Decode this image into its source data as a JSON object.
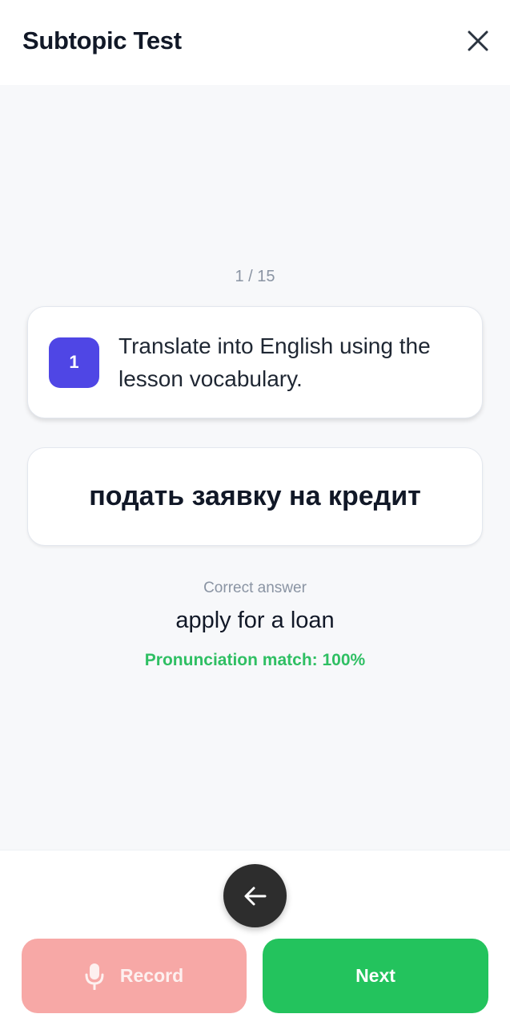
{
  "header": {
    "title": "Subtopic Test",
    "close_icon": "close-icon"
  },
  "progress": {
    "counter": "1 / 15"
  },
  "question": {
    "number": "1",
    "prompt": "Translate into English using the lesson vocabulary.",
    "accent_color": "#4f46e5"
  },
  "phrase": {
    "text": "подать заявку на кредит"
  },
  "answer": {
    "label": "Correct answer",
    "text": "apply for a loan",
    "pronunciation": "Pronunciation match: 100%",
    "pronunciation_color": "#2fbf63"
  },
  "footer": {
    "back_icon": "arrow-left-icon",
    "record_label": "Record",
    "record_icon": "microphone-icon",
    "record_color": "#f7a8a6",
    "next_label": "Next",
    "next_color": "#23c35d"
  }
}
